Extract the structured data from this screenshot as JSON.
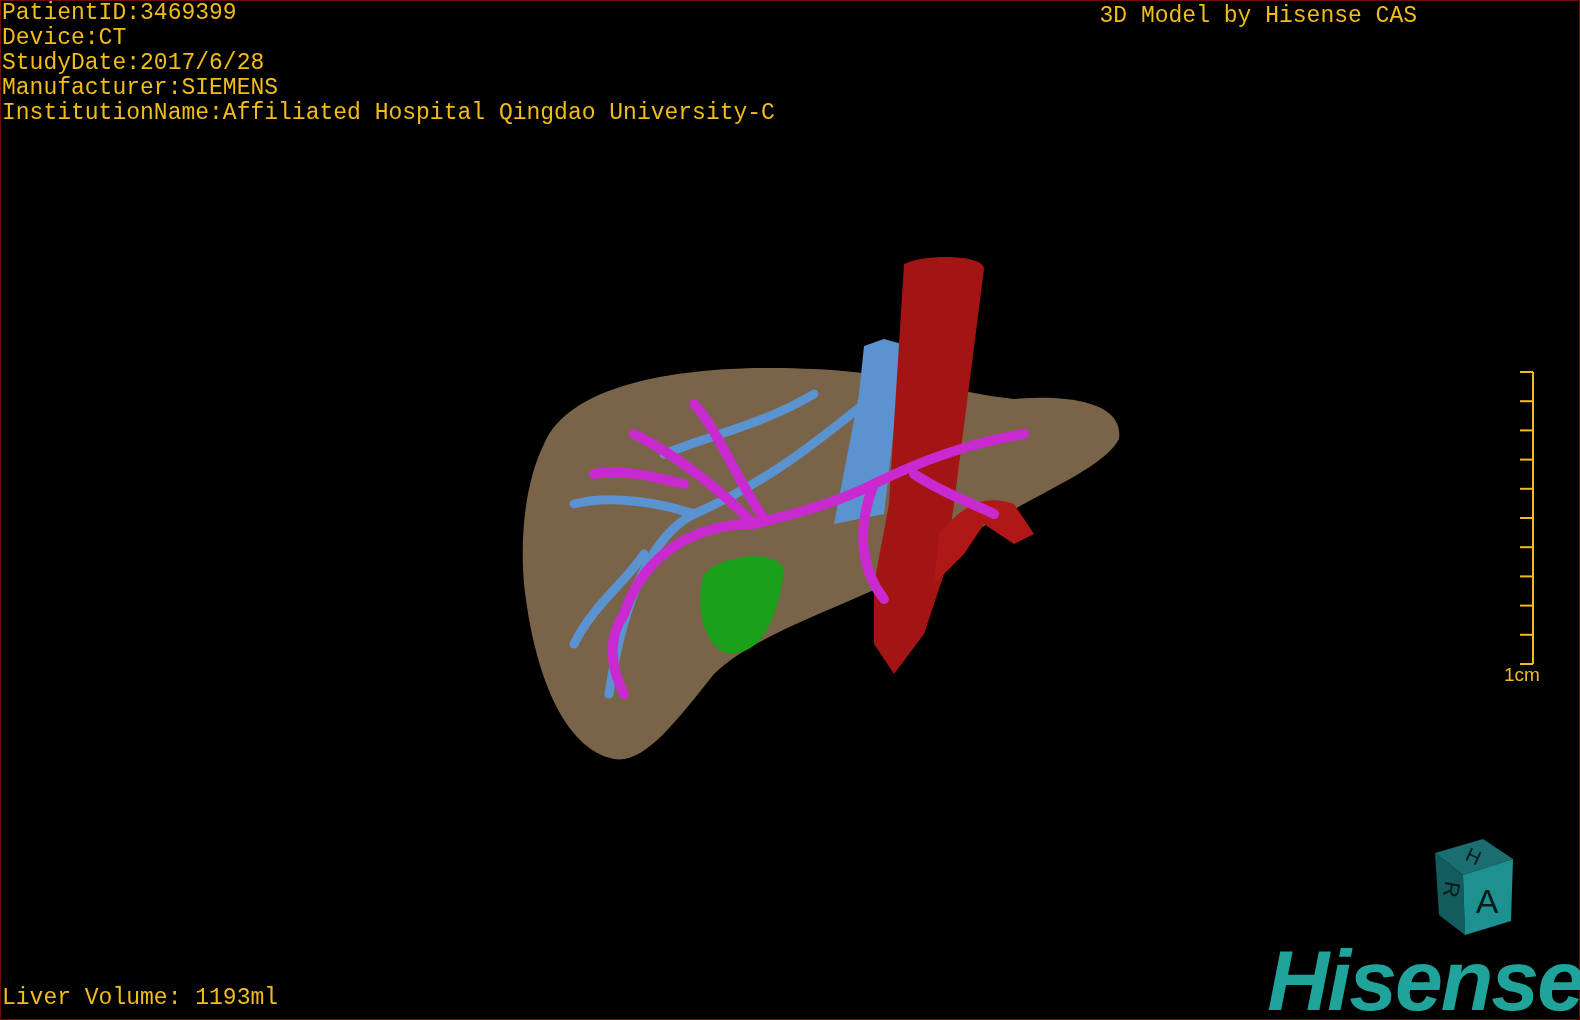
{
  "patient_info": [
    "PatientID:3469399",
    "Device:CT",
    "StudyDate:2017/6/28",
    "Manufacturer:SIEMENS",
    "InstitutionName:Affiliated Hospital Qingdao University-C"
  ],
  "title": "3D Model by Hisense CAS",
  "scale_bar": {
    "label": "1cm"
  },
  "liver_volume": "Liver Volume: 1193ml",
  "orientation_cube": {
    "faces": [
      "H",
      "R",
      "A"
    ]
  },
  "logo": "Hisense"
}
